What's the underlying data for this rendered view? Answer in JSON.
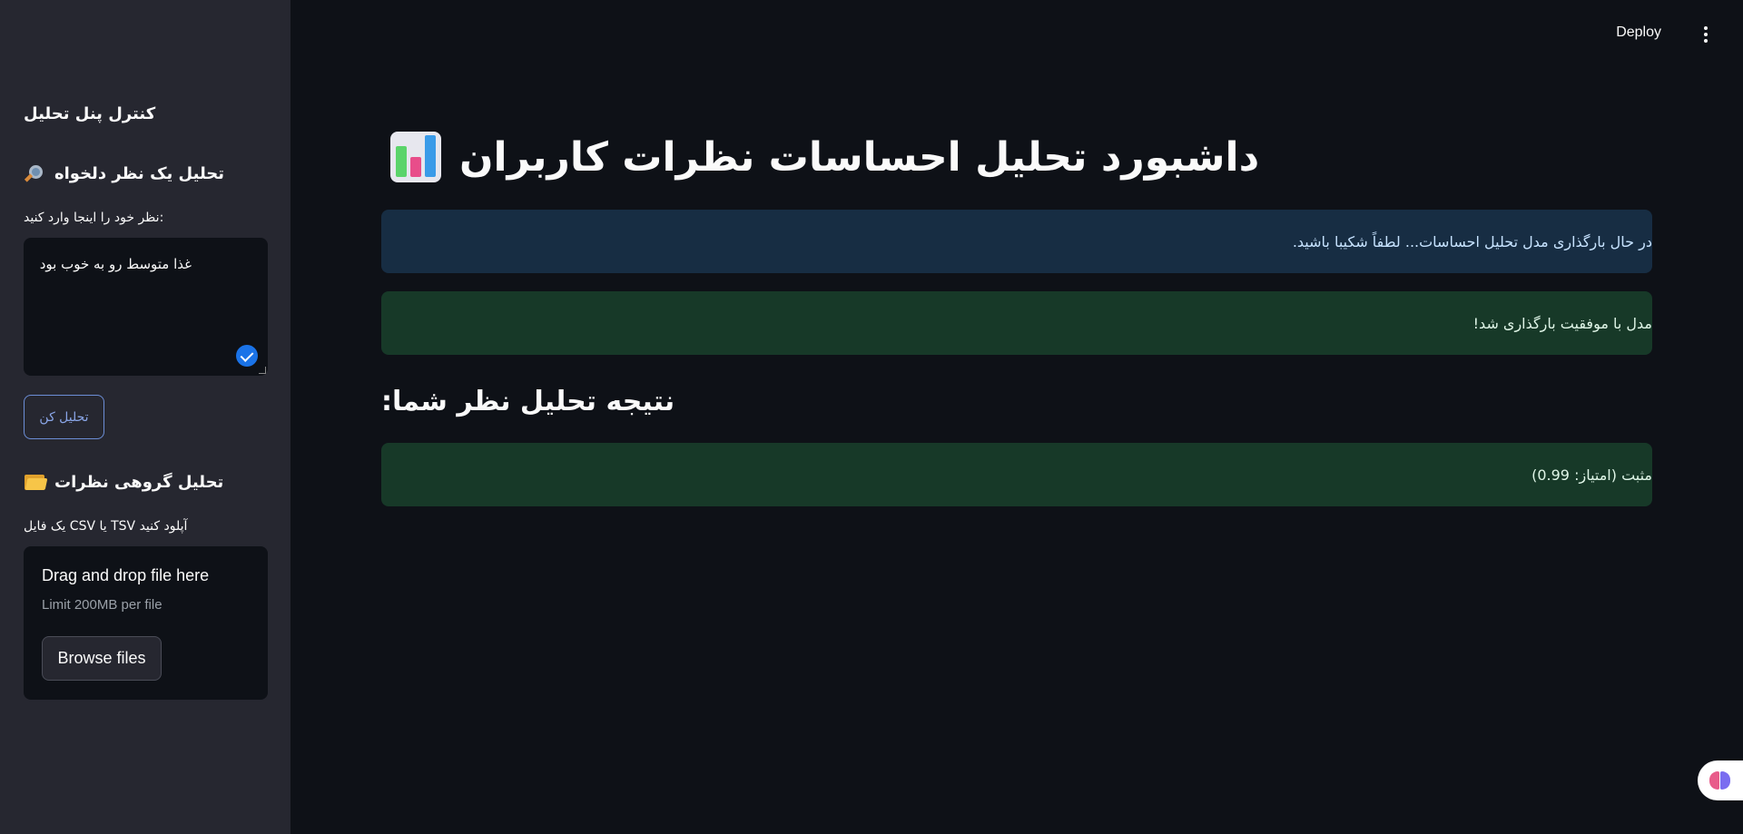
{
  "sidebar": {
    "title": "کنترل پنل تحلیل",
    "single_section": {
      "heading": "تحلیل یک نظر دلخواه",
      "icon": "magnifier-icon",
      "input_label": "نظر خود را اینجا وارد کنید:",
      "input_value": "غذا متوسط رو به خوب بود",
      "button_label": "تحلیل کن"
    },
    "group_section": {
      "heading": "تحلیل گروهی نظرات",
      "icon": "folder-icon",
      "upload_label": "یک فایل CSV یا TSV آپلود کنید",
      "dropzone_title": "Drag and drop file here",
      "dropzone_limit": "Limit 200MB per file",
      "browse_label": "Browse files"
    }
  },
  "header": {
    "deploy_label": "Deploy",
    "menu_icon": "kebab-menu-icon"
  },
  "main": {
    "title": "داشبورد تحلیل احساسات نظرات کاربران",
    "title_icon": "bar-chart-icon",
    "alerts": {
      "loading": "در حال بارگذاری مدل تحلیل احساسات... لطفاً شکیبا باشید.",
      "loaded": "مدل با موفقیت بارگذاری شد!"
    },
    "result_heading": "نتیجه تحلیل نظر شما:",
    "result_text": "مثبت (امتیاز: 0.99)"
  },
  "colors": {
    "sidebar_bg": "#262730",
    "main_bg": "#0e1117",
    "info_bg": "#172d43",
    "success_bg": "#173928",
    "accent": "#1a73e8"
  }
}
